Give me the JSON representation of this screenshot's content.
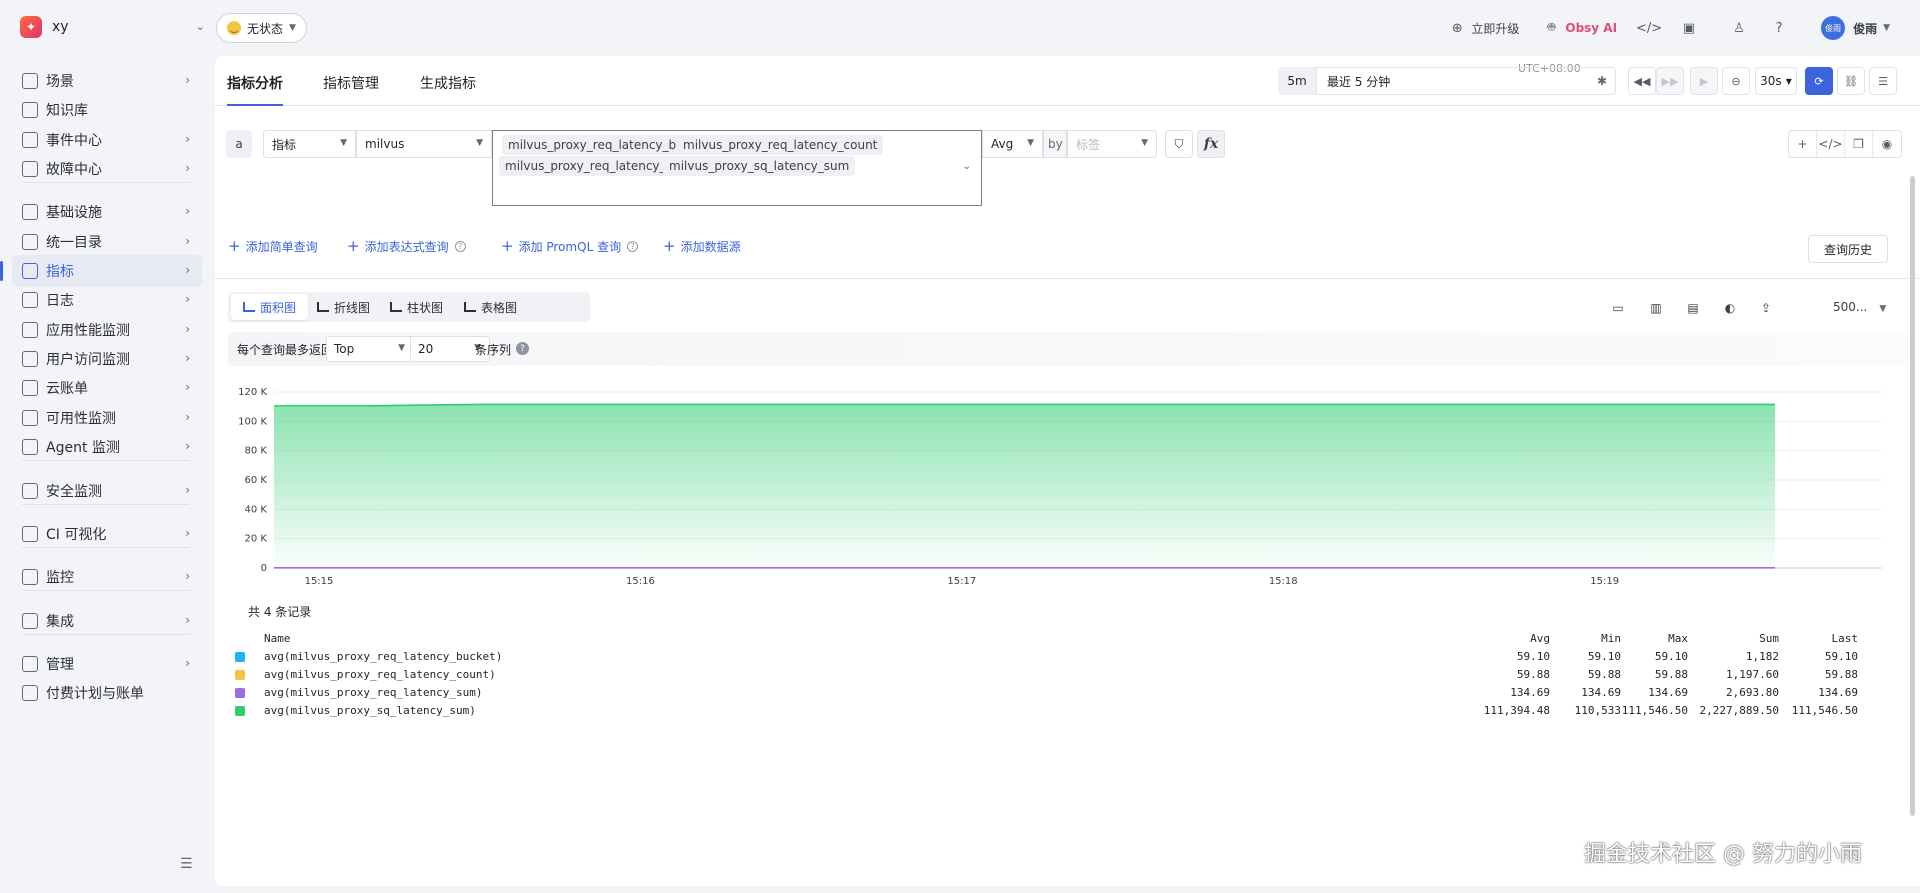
{
  "workspace": {
    "logo": "xy",
    "name": "xy"
  },
  "status_pill": {
    "label": "无状态"
  },
  "header": {
    "upgrade": "立即升级",
    "obsy": "Obsy AI",
    "user_avatar": "俊雨",
    "user_name": "俊雨"
  },
  "sidebar": {
    "items": [
      {
        "label": "场景",
        "icon": "scene-icon",
        "chevron": true
      },
      {
        "label": "知识库",
        "icon": "book-icon",
        "chevron": false
      },
      {
        "label": "事件中心",
        "icon": "calendar-icon",
        "chevron": true
      },
      {
        "label": "故障中心",
        "icon": "target-icon",
        "chevron": true
      },
      {
        "label": "基础设施",
        "icon": "cluster-icon",
        "chevron": true
      },
      {
        "label": "统一目录",
        "icon": "catalog-icon",
        "chevron": true
      },
      {
        "label": "指标",
        "icon": "metrics-icon",
        "chevron": true,
        "active": true
      },
      {
        "label": "日志",
        "icon": "log-icon",
        "chevron": true
      },
      {
        "label": "应用性能监测",
        "icon": "apm-icon",
        "chevron": true
      },
      {
        "label": "用户访问监测",
        "icon": "user-icon",
        "chevron": true
      },
      {
        "label": "云账单",
        "icon": "cloud-icon",
        "chevron": true
      },
      {
        "label": "可用性监测",
        "icon": "availability-icon",
        "chevron": true
      },
      {
        "label": "Agent 监测",
        "icon": "agent-icon",
        "chevron": true
      },
      {
        "label": "安全监测",
        "icon": "shield-icon",
        "chevron": true
      },
      {
        "label": "CI 可视化",
        "icon": "ci-icon",
        "chevron": true
      },
      {
        "label": "监控",
        "icon": "monitor-icon",
        "chevron": true
      },
      {
        "label": "集成",
        "icon": "integration-icon",
        "chevron": true
      },
      {
        "label": "管理",
        "icon": "settings-icon",
        "chevron": true
      },
      {
        "label": "付费计划与账单",
        "icon": "billing-icon",
        "chevron": false
      }
    ]
  },
  "tabs": [
    "指标分析",
    "指标管理",
    "生成指标"
  ],
  "timebar": {
    "timezone": "UTC+08:00",
    "short": "5m",
    "range": "最近 5 分钟",
    "interval": "30s"
  },
  "query": {
    "letter": "a",
    "type": "指标",
    "source": "milvus",
    "metrics": [
      "milvus_proxy_req_latency_bucket",
      "milvus_proxy_req_latency_count",
      "milvus_proxy_req_latency_sum",
      "milvus_proxy_sq_latency_sum"
    ],
    "agg": "Avg",
    "by": "by",
    "by_placeholder": "标签",
    "fx": "fx"
  },
  "add_links": [
    {
      "label": "添加简单查询",
      "help": false
    },
    {
      "label": "添加表达式查询",
      "help": true
    },
    {
      "label": "添加 PromQL 查询",
      "help": true
    },
    {
      "label": "添加数据源",
      "help": false
    }
  ],
  "history_button": "查询历史",
  "chart_tabs": [
    {
      "label": "面积图",
      "active": true
    },
    {
      "label": "折线图",
      "active": false
    },
    {
      "label": "柱状图",
      "active": false
    },
    {
      "label": "表格图",
      "active": false
    }
  ],
  "chart_tools": {
    "limit_display": "500..."
  },
  "limit_row": {
    "label": "每个查询最多返回",
    "order": "Top",
    "count": "20",
    "suffix": "条序列"
  },
  "colors": {
    "accent": "#3d63dd",
    "bucket": "#1fb5f0",
    "count": "#f5c542",
    "sum": "#9b6ee0",
    "sq_sum": "#2ecc71"
  },
  "chart_data": {
    "type": "area",
    "y_ticks": [
      "0",
      "20 K",
      "40 K",
      "60 K",
      "80 K",
      "100 K",
      "120 K"
    ],
    "ylim": [
      0,
      120000
    ],
    "x_ticks": [
      "15:15",
      "15:16",
      "15:17",
      "15:18",
      "15:19"
    ],
    "x_minutes": [
      0,
      1,
      2,
      3,
      4
    ],
    "x_range_minutes": [
      -0.14,
      4.53
    ],
    "grid": true,
    "series": [
      {
        "name": "avg(milvus_proxy_sq_latency_sum)",
        "color": "#2ecc71",
        "x": [
          -0.14,
          0.15,
          0.3,
          0.5,
          1.0,
          2.0,
          3.0,
          4.0,
          4.53
        ],
        "y": [
          110533,
          110533,
          111000,
          111546.5,
          111546.5,
          111546.5,
          111546.5,
          111546.5,
          111546.5
        ]
      },
      {
        "name": "avg(milvus_proxy_req_latency_sum)",
        "color": "#9b6ee0",
        "x": [
          -0.14,
          4.53
        ],
        "y": [
          134.69,
          134.69
        ]
      }
    ]
  },
  "records": {
    "summary": "共 4 条记录"
  },
  "legend_table": {
    "headers": [
      "Name",
      "Avg",
      "Min",
      "Max",
      "Sum",
      "Last"
    ],
    "rows": [
      {
        "name": "avg(milvus_proxy_req_latency_bucket)",
        "color": "#1fb5f0",
        "avg": "59.10",
        "min": "59.10",
        "max": "59.10",
        "sum": "1,182",
        "last": "59.10"
      },
      {
        "name": "avg(milvus_proxy_req_latency_count)",
        "color": "#f5c542",
        "avg": "59.88",
        "min": "59.88",
        "max": "59.88",
        "sum": "1,197.60",
        "last": "59.88"
      },
      {
        "name": "avg(milvus_proxy_req_latency_sum)",
        "color": "#9b6ee0",
        "avg": "134.69",
        "min": "134.69",
        "max": "134.69",
        "sum": "2,693.80",
        "last": "134.69"
      },
      {
        "name": "avg(milvus_proxy_sq_latency_sum)",
        "color": "#2ecc71",
        "avg": "111,394.48",
        "min": "110,533",
        "max": "111,546.50",
        "sum": "2,227,889.50",
        "last": "111,546.50"
      }
    ]
  },
  "watermark": "掘金技术社区 @ 努力的小雨"
}
